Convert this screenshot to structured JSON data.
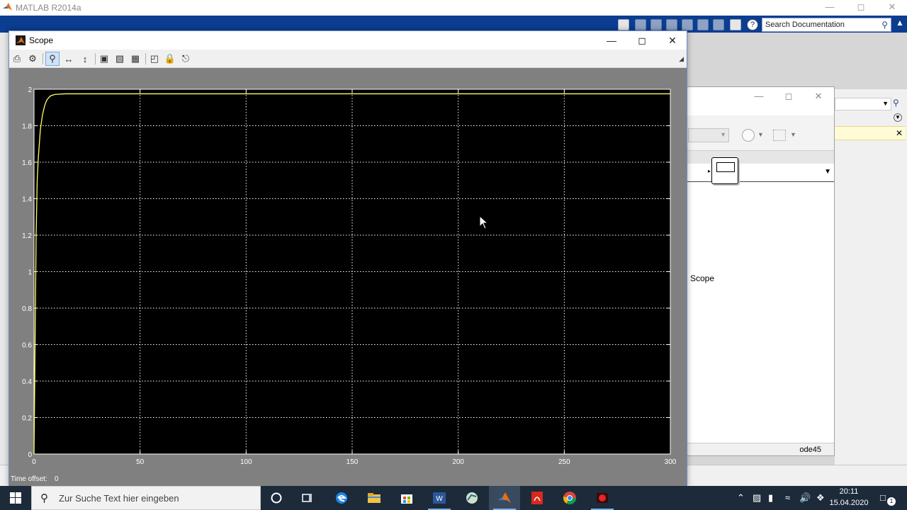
{
  "matlab": {
    "title": "MATLAB R2014a",
    "search_placeholder": "Search Documentation"
  },
  "model": {
    "scope_block_label": "Scope",
    "solver": "ode45"
  },
  "scope": {
    "title": "Scope",
    "time_offset_label": "Time offset:",
    "time_offset_value": "0",
    "toolbar": [
      "print-icon",
      "parameters-icon",
      "zoom-in-icon",
      "zoom-x-icon",
      "zoom-y-icon",
      "autoscale-icon",
      "save-axes-icon",
      "restore-axes-icon",
      "floating-scope-icon",
      "lock-axes-icon",
      "signal-selector-icon"
    ]
  },
  "chart_data": {
    "type": "line",
    "title": "",
    "xlabel": "",
    "ylabel": "",
    "xlim": [
      0,
      300
    ],
    "ylim": [
      0,
      2
    ],
    "x_ticks": [
      "0",
      "50",
      "100",
      "150",
      "200",
      "250",
      "300"
    ],
    "y_ticks": [
      "0",
      "0.2",
      "0.4",
      "0.6",
      "0.8",
      "1",
      "1.2",
      "1.4",
      "1.6",
      "1.8",
      "2"
    ],
    "grid": true,
    "background": "#000000",
    "line_color": "#ffff66",
    "series": [
      {
        "x": [
          0,
          0.5,
          1,
          1.5,
          2,
          3,
          4,
          5,
          6,
          7,
          8,
          10,
          15,
          20,
          50,
          100,
          150,
          200,
          250,
          300
        ],
        "values": [
          0,
          0.6,
          1.2,
          1.5,
          1.62,
          1.78,
          1.86,
          1.91,
          1.94,
          1.955,
          1.965,
          1.972,
          1.975,
          1.975,
          1.975,
          1.975,
          1.975,
          1.975,
          1.975,
          1.975
        ]
      }
    ]
  },
  "taskbar": {
    "search_placeholder": "Zur Suche Text hier eingeben",
    "time": "20:11",
    "date": "15.04.2020",
    "notification_count": "1"
  },
  "colors": {
    "toolstrip": "#0b3d91",
    "plot_background": "#000000",
    "figure_background": "#808080",
    "signal": "#ffff66",
    "taskbar": "#1c2a3a"
  }
}
